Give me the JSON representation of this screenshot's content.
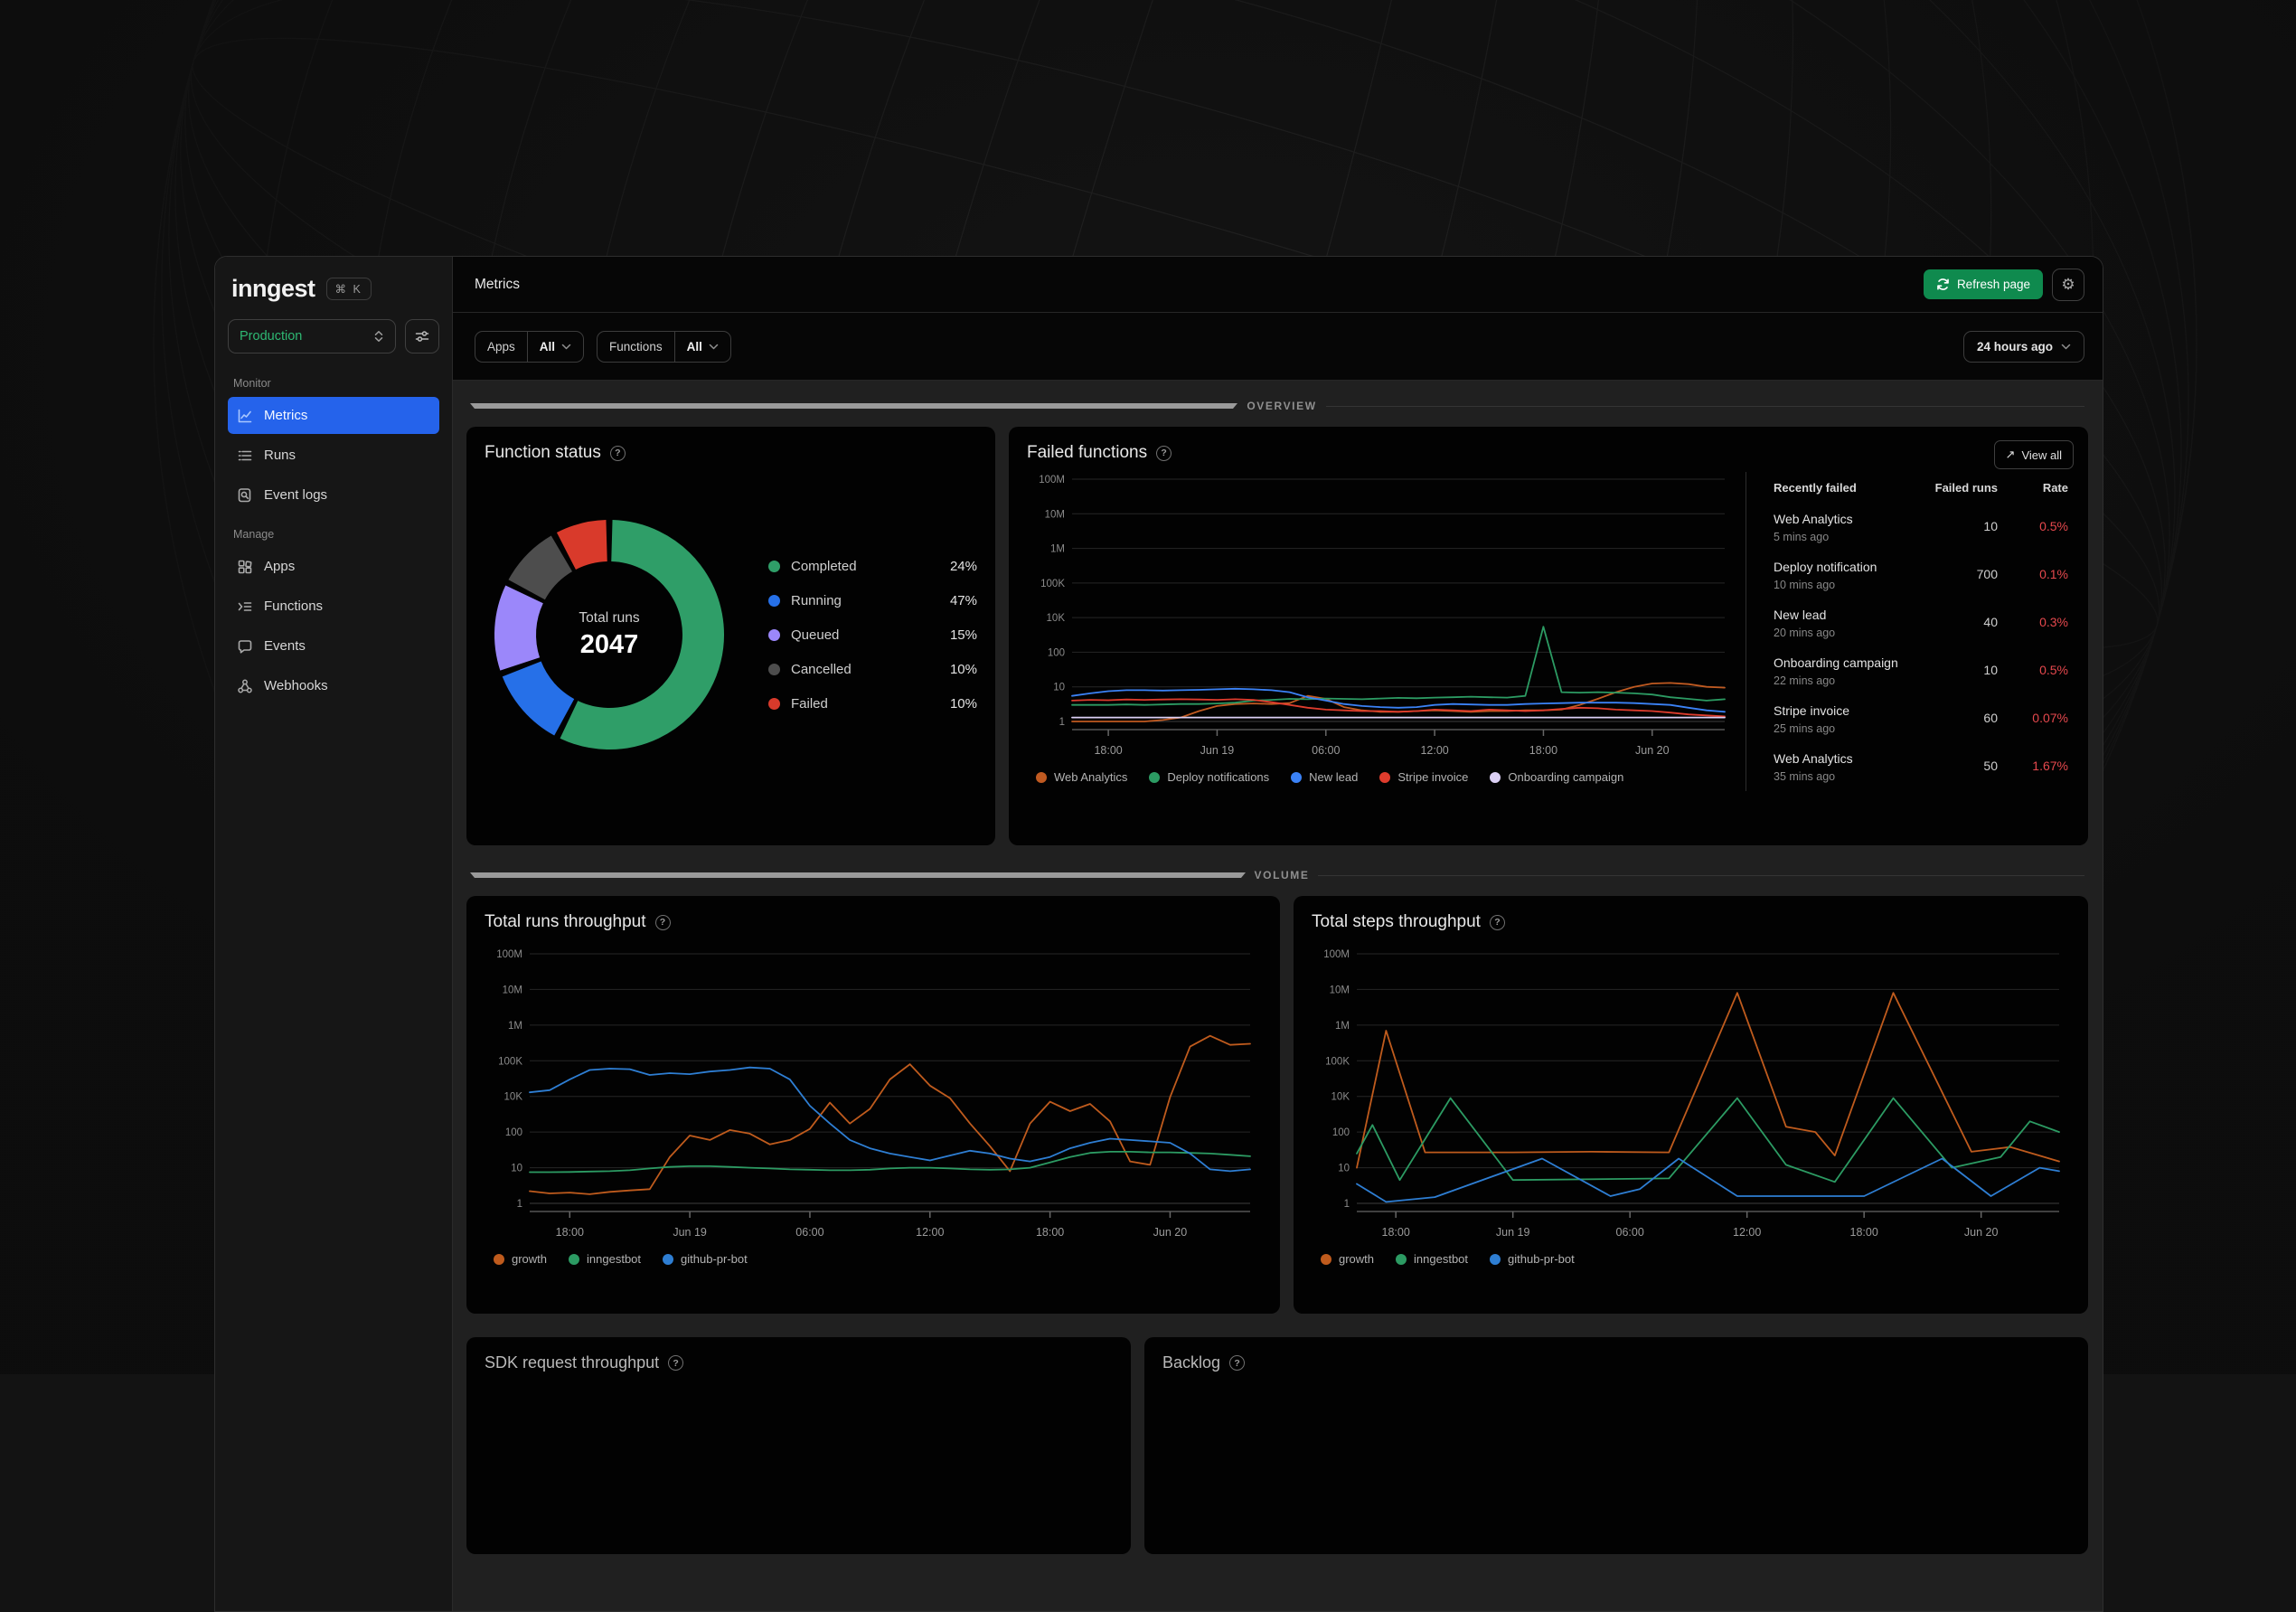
{
  "sidebar": {
    "logo": "inngest",
    "kbd": "⌘ K",
    "environment": "Production",
    "monitor_label": "Monitor",
    "manage_label": "Manage",
    "monitor_items": [
      {
        "label": "Metrics",
        "icon": "chart-line-icon",
        "active": true
      },
      {
        "label": "Runs",
        "icon": "runs-list-icon",
        "active": false
      },
      {
        "label": "Event logs",
        "icon": "event-logs-icon",
        "active": false
      }
    ],
    "manage_items": [
      {
        "label": "Apps",
        "icon": "apps-grid-icon"
      },
      {
        "label": "Functions",
        "icon": "functions-list-icon"
      },
      {
        "label": "Events",
        "icon": "events-bubble-icon"
      },
      {
        "label": "Webhooks",
        "icon": "webhooks-icon"
      }
    ]
  },
  "topbar": {
    "title": "Metrics",
    "refresh_label": "Refresh page"
  },
  "filters": {
    "apps_label": "Apps",
    "apps_value": "All",
    "functions_label": "Functions",
    "functions_value": "All",
    "time_range": "24 hours ago"
  },
  "sections": {
    "overview": "OVERVIEW",
    "volume": "VOLUME"
  },
  "chart_data": {
    "function_status": {
      "type": "donut",
      "title": "Function status",
      "center_label": "Total runs",
      "center_value": "2047",
      "arc_fractions": [
        0.575,
        0.12,
        0.13,
        0.095,
        0.08
      ],
      "legend": [
        {
          "label": "Completed",
          "percent": "24%",
          "color": "#2f9e68"
        },
        {
          "label": "Running",
          "percent": "47%",
          "color": "#2670e8"
        },
        {
          "label": "Queued",
          "percent": "15%",
          "color": "#9b87fa"
        },
        {
          "label": "Cancelled",
          "percent": "10%",
          "color": "#4d4d4d"
        },
        {
          "label": "Failed",
          "percent": "10%",
          "color": "#d93a2b"
        }
      ]
    },
    "failed_functions": {
      "type": "line",
      "title": "Failed functions",
      "view_all": "View all",
      "y_ticks": [
        "100M",
        "10M",
        "1M",
        "100K",
        "10K",
        "100",
        "10",
        "1"
      ],
      "x_max": 36,
      "x_ticks": [
        {
          "t": 2,
          "label": "18:00"
        },
        {
          "t": 8,
          "label": "Jun 19"
        },
        {
          "t": 14,
          "label": "06:00"
        },
        {
          "t": 20,
          "label": "12:00"
        },
        {
          "t": 26,
          "label": "18:00"
        },
        {
          "t": 32,
          "label": "Jun 20"
        }
      ],
      "series": [
        {
          "name": "Web Analytics",
          "color": "#c05a21",
          "values": [
            1,
            1,
            1,
            1,
            1,
            1.1,
            1.3,
            2,
            2.8,
            3.2,
            3.3,
            3.2,
            3.4,
            5.5,
            4.5,
            2.6,
            2.1,
            1.9,
            1.9,
            2,
            2.1,
            2,
            1.9,
            2,
            2,
            2.1,
            2.1,
            2.2,
            3,
            4.5,
            7,
            10,
            12.5,
            13,
            12,
            10,
            9.5
          ]
        },
        {
          "name": "Deploy notifications",
          "color": "#2c9b63",
          "values": [
            3,
            3,
            3,
            3.1,
            3,
            3.1,
            3.2,
            3.2,
            3.3,
            3.5,
            4,
            4.2,
            4.5,
            4.4,
            4.6,
            4.5,
            4.4,
            4.6,
            4.8,
            4.7,
            4.9,
            5,
            5.2,
            5,
            4.9,
            5.5,
            3000,
            7,
            6.8,
            7,
            6.8,
            6.5,
            6,
            5,
            4.5,
            4,
            4.4
          ]
        },
        {
          "name": "New lead",
          "color": "#3b82f6",
          "values": [
            5.5,
            6.5,
            7.5,
            8,
            8,
            7.8,
            8,
            8.2,
            8.5,
            8.8,
            8.5,
            8,
            7,
            5,
            4,
            3.2,
            2.8,
            2.6,
            2.5,
            2.6,
            3,
            3.2,
            3.1,
            3,
            3,
            3.2,
            3.3,
            3.4,
            3.5,
            3.5,
            3.5,
            3.4,
            3.2,
            3,
            2.5,
            2.1,
            1.9
          ]
        },
        {
          "name": "Stripe invoice",
          "color": "#de3c2d",
          "values": [
            4,
            4.2,
            4.1,
            4.3,
            4.2,
            4.3,
            4.4,
            4.3,
            4.2,
            4.4,
            4.2,
            3.6,
            3,
            2.5,
            2.2,
            2.1,
            2,
            2,
            1.9,
            2,
            2.2,
            2.1,
            2,
            2.2,
            2.1,
            2,
            2.1,
            2.3,
            2.5,
            2.4,
            2.2,
            2.1,
            2,
            1.8,
            1.6,
            1.5,
            1.4
          ]
        },
        {
          "name": "Onboarding campaign",
          "color": "#dcd0f5",
          "values": [
            1.3,
            1.3,
            1.3,
            1.3,
            1.3,
            1.3,
            1.3,
            1.3,
            1.3,
            1.3,
            1.3,
            1.3,
            1.3,
            1.3,
            1.3,
            1.3,
            1.3,
            1.3,
            1.3,
            1.3,
            1.3,
            1.3,
            1.3,
            1.3,
            1.3,
            1.3,
            1.3,
            1.3,
            1.3,
            1.3,
            1.3,
            1.3,
            1.3,
            1.3,
            1.3,
            1.3,
            1.3
          ]
        }
      ]
    },
    "runs_throughput": {
      "type": "line",
      "title": "Total runs throughput",
      "y_ticks": [
        "100M",
        "10M",
        "1M",
        "100K",
        "10K",
        "100",
        "10",
        "1"
      ],
      "x_max": 36,
      "x_ticks": [
        {
          "t": 2,
          "label": "18:00"
        },
        {
          "t": 8,
          "label": "Jun 19"
        },
        {
          "t": 14,
          "label": "06:00"
        },
        {
          "t": 20,
          "label": "12:00"
        },
        {
          "t": 26,
          "label": "18:00"
        },
        {
          "t": 32,
          "label": "Jun 20"
        }
      ],
      "series": [
        {
          "name": "growth",
          "color": "#bf5b1d",
          "values": [
            2.2,
            1.9,
            2,
            1.8,
            2.1,
            2.3,
            2.5,
            20,
            80,
            60,
            130,
            90,
            45,
            60,
            150,
            4500,
            300,
            2000,
            30000,
            80000,
            20000,
            8000,
            300,
            40,
            8,
            300,
            5000,
            1500,
            3800,
            400,
            15,
            12,
            9000,
            250000,
            500000,
            280000,
            300000
          ]
        },
        {
          "name": "inngestbot",
          "color": "#2c9b63",
          "values": [
            7.5,
            7.5,
            7.6,
            7.8,
            8,
            8.5,
            9.5,
            10.5,
            11,
            11,
            10.5,
            10,
            9.5,
            9,
            8.8,
            8.5,
            8.5,
            8.8,
            9.5,
            10,
            10,
            9.5,
            9,
            8.8,
            9,
            10,
            14,
            20,
            26,
            28,
            28,
            27,
            27,
            26,
            25,
            23,
            21
          ]
        },
        {
          "name": "github-pr-bot",
          "color": "#2e7ed3",
          "values": [
            13000,
            15000,
            30000,
            55000,
            60000,
            58000,
            40000,
            45000,
            42000,
            50000,
            55000,
            65000,
            60000,
            30000,
            3000,
            300,
            60,
            35,
            25,
            20,
            16,
            22,
            30,
            25,
            18,
            15,
            20,
            35,
            50,
            65,
            60,
            55,
            50,
            25,
            9,
            8,
            9
          ]
        }
      ]
    },
    "steps_throughput": {
      "type": "line",
      "title": "Total steps throughput",
      "y_ticks": [
        "100M",
        "10M",
        "1M",
        "100K",
        "10K",
        "100",
        "10",
        "1"
      ],
      "x_max": 36,
      "x_ticks": [
        {
          "t": 2,
          "label": "18:00"
        },
        {
          "t": 8,
          "label": "Jun 19"
        },
        {
          "t": 14,
          "label": "06:00"
        },
        {
          "t": 20,
          "label": "12:00"
        },
        {
          "t": 26,
          "label": "18:00"
        },
        {
          "t": 32,
          "label": "Jun 20"
        }
      ],
      "series": [
        {
          "name": "growth",
          "color": "#bf5b1d",
          "points": [
            [
              0,
              10
            ],
            [
              1.5,
              700000
            ],
            [
              3.5,
              27
            ],
            [
              8,
              27
            ],
            [
              12,
              28
            ],
            [
              16,
              27
            ],
            [
              19.5,
              8000000
            ],
            [
              22,
              200
            ],
            [
              23.5,
              100
            ],
            [
              24.5,
              22
            ],
            [
              27.5,
              8000000
            ],
            [
              31.5,
              28
            ],
            [
              33.5,
              38
            ],
            [
              36,
              15
            ]
          ]
        },
        {
          "name": "inngestbot",
          "color": "#2c9b63",
          "points": [
            [
              0,
              25
            ],
            [
              0.8,
              250
            ],
            [
              2.2,
              4.5
            ],
            [
              4.8,
              8000
            ],
            [
              8,
              4.5
            ],
            [
              16,
              5
            ],
            [
              19.5,
              8000
            ],
            [
              22,
              12
            ],
            [
              24.5,
              4
            ],
            [
              27.5,
              8000
            ],
            [
              30.5,
              10
            ],
            [
              33,
              20
            ],
            [
              34.5,
              400
            ],
            [
              36,
              100
            ]
          ]
        },
        {
          "name": "github-pr-bot",
          "color": "#2e7ed3",
          "points": [
            [
              0,
              3.5
            ],
            [
              1.5,
              1.1
            ],
            [
              4,
              1.5
            ],
            [
              9.5,
              18
            ],
            [
              13,
              1.6
            ],
            [
              14.5,
              2.5
            ],
            [
              16.5,
              18
            ],
            [
              19.5,
              1.6
            ],
            [
              26,
              1.6
            ],
            [
              30,
              18
            ],
            [
              32.5,
              1.6
            ],
            [
              35,
              10
            ],
            [
              36,
              8
            ]
          ]
        }
      ]
    }
  },
  "failed_table": {
    "headers": [
      "Recently failed",
      "Failed runs",
      "Rate"
    ],
    "rows": [
      {
        "name": "Web Analytics",
        "ago": "5 mins ago",
        "runs": "10",
        "rate": "0.5%"
      },
      {
        "name": "Deploy notification",
        "ago": "10 mins ago",
        "runs": "700",
        "rate": "0.1%"
      },
      {
        "name": "New lead",
        "ago": "20 mins ago",
        "runs": "40",
        "rate": "0.3%"
      },
      {
        "name": "Onboarding campaign",
        "ago": "22 mins ago",
        "runs": "10",
        "rate": "0.5%"
      },
      {
        "name": "Stripe invoice",
        "ago": "25 mins ago",
        "runs": "60",
        "rate": "0.07%"
      },
      {
        "name": "Web Analytics",
        "ago": "35 mins ago",
        "runs": "50",
        "rate": "1.67%"
      }
    ]
  },
  "partial_cards": {
    "sdk": "SDK request throughput",
    "backlog": "Backlog"
  }
}
